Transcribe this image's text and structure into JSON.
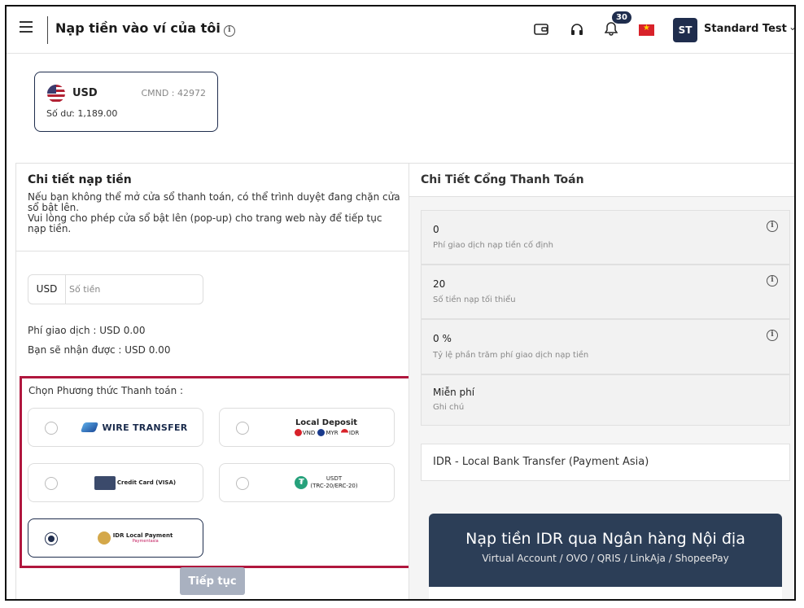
{
  "header": {
    "title": "Nạp tiền vào ví của tôi",
    "notifications_count": "30",
    "user_initials": "ST",
    "user_name": "Standard Test"
  },
  "account": {
    "currency": "USD",
    "id_label": "CMND : 42972",
    "balance": "Số dư: 1,189.00"
  },
  "deposit_details": {
    "title": "Chi tiết nạp tiền",
    "description_1": "Nếu bạn không thể mở cửa sổ thanh toán, có thể trình duyệt đang chặn cửa sổ bật lên.",
    "description_2": "Vui lòng cho phép cửa sổ bật lên (pop-up) cho trang web này để tiếp tục nạp tiền.",
    "amount_currency": "USD",
    "amount_placeholder": "Số tiền",
    "fee_text": "Phí giao dịch : USD 0.00",
    "receive_text": "Bạn sẽ nhận được : USD 0.00",
    "payment_method_label": "Chọn Phương thức Thanh toán :",
    "methods": {
      "wire": "WIRE TRANSFER",
      "local_deposit_title": "Local Deposit",
      "local_deposit_currencies": [
        "VND",
        "MYR",
        "IDR"
      ],
      "credit_card": "Credit Card (VISA)",
      "usdt": "USDT",
      "usdt_sub": "(TRC-20/ERC-20)",
      "idr_local": "IDR Local Payment",
      "idr_local_sub": "Paymentasia"
    },
    "selected_method": "idr_local",
    "continue_button": "Tiếp tục"
  },
  "gateway": {
    "title": "Chi Tiết Cổng Thanh Toán",
    "stats": [
      {
        "value": "0",
        "label": "Phí giao dịch nạp tiền cố định"
      },
      {
        "value": "20",
        "label": "Số tiền nạp tối thiểu"
      },
      {
        "value": "0 %",
        "label": "Tỷ lệ phần trăm phí giao dịch nạp tiền"
      },
      {
        "value": "Miễn phí",
        "label": "Ghi chú"
      }
    ],
    "selected_gateway": "IDR - Local Bank Transfer (Payment Asia)",
    "banner_title": "Nạp tiền IDR qua Ngân hàng Nội địa",
    "banner_subtitle": "Virtual Account / OVO / QRIS / LinkAja / ShopeePay"
  },
  "colors": {
    "navy": "#1f2d4d",
    "highlight": "#b0173e",
    "button_disabled": "#a9b1c0"
  }
}
